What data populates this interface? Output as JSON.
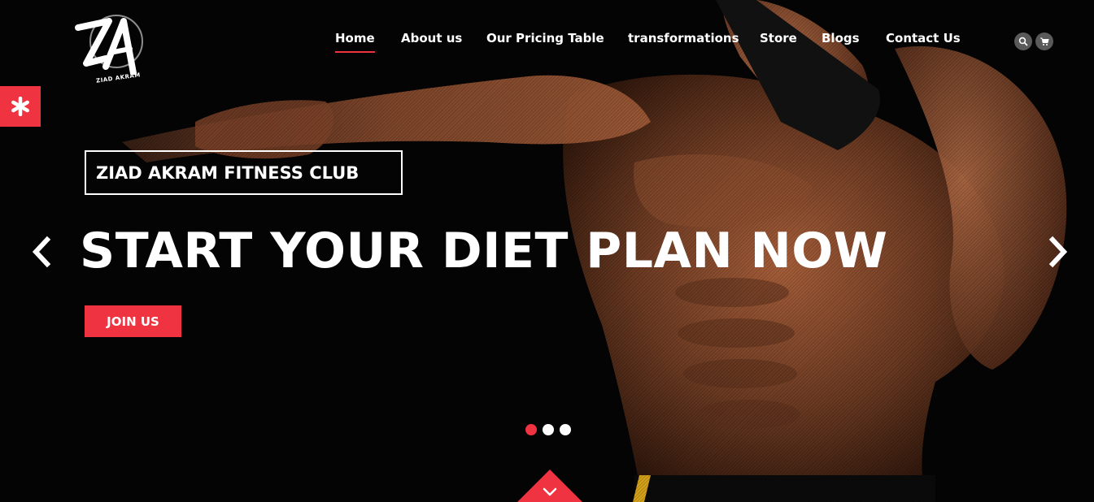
{
  "logo": {
    "sub_text": "ZIAD AKRAM"
  },
  "nav": {
    "items": [
      {
        "label": "Home",
        "active": true
      },
      {
        "label": "About us"
      },
      {
        "label": "Our Pricing Table"
      },
      {
        "label": "transformations"
      },
      {
        "label": "Store"
      },
      {
        "label": "Blogs"
      },
      {
        "label": "Contact Us"
      }
    ]
  },
  "header_icons": {
    "search": "search-icon",
    "cart": "cart-icon"
  },
  "side_tab": {
    "icon": "asterisk-icon"
  },
  "hero": {
    "club_name": "ZIAD AKRAM FITNESS CLUB",
    "headline": "START YOUR DIET PLAN NOW",
    "cta_label": "JOIN US"
  },
  "slider": {
    "slide_count": 3,
    "active_index": 0
  },
  "colors": {
    "accent": "#ef3340",
    "background": "#000000",
    "text": "#ffffff"
  }
}
